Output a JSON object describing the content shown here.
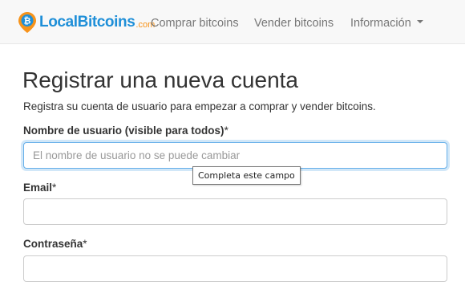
{
  "navbar": {
    "brand": {
      "name": "LocalBitcoins",
      "suffix": ".com",
      "icon": "bitcoin-pin-icon"
    },
    "links": {
      "buy": "Comprar bitcoins",
      "sell": "Vender bitcoins",
      "info": "Información"
    },
    "info_icon": "caret-down-icon"
  },
  "main": {
    "title": "Registrar una nueva cuenta",
    "subtitle": "Registra su cuenta de usuario para empezar a comprar y vender bitcoins."
  },
  "form": {
    "username": {
      "label": "Nombre de usuario (visible para todos)",
      "required_mark": "*",
      "placeholder": "El nombre de usuario no se puede cambiar",
      "value": ""
    },
    "email": {
      "label": "Email",
      "required_mark": "*",
      "value": ""
    },
    "password": {
      "label": "Contraseña",
      "required_mark": "*",
      "value": ""
    }
  },
  "tooltip": {
    "text": "Completa este campo"
  },
  "colors": {
    "brand_blue": "#1f8fd8",
    "brand_orange": "#f7931a",
    "focus_border": "#66afe9"
  }
}
